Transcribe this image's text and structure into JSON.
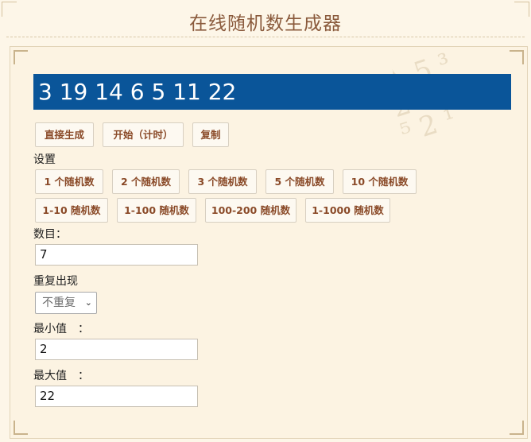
{
  "app": {
    "title": "在线随机数生成器"
  },
  "result": {
    "text": "3 19 14 6 5 11 22"
  },
  "actions": [
    {
      "label": "直接生成"
    },
    {
      "label": "开始（计时）"
    },
    {
      "label": "复制"
    }
  ],
  "settings": {
    "heading": "设置",
    "count_presets": [
      {
        "label": "1 个随机数"
      },
      {
        "label": "2 个随机数"
      },
      {
        "label": "3 个随机数"
      },
      {
        "label": "5 个随机数"
      },
      {
        "label": "10 个随机数"
      }
    ],
    "range_presets": [
      {
        "label": "1-10 随机数"
      },
      {
        "label": "1-100 随机数"
      },
      {
        "label": "100-200 随机数"
      },
      {
        "label": "1-1000 随机数"
      }
    ]
  },
  "form": {
    "count": {
      "label": "数目：",
      "value": "7"
    },
    "repeat": {
      "label": "重复出现",
      "value": "不重复"
    },
    "min": {
      "label": "最小值　：",
      "value": "2"
    },
    "max": {
      "label": "最大值　：",
      "value": "22"
    }
  },
  "icons": {
    "select_chevron": "chevron-down-icon"
  },
  "colors": {
    "accent": "#0a5599",
    "title": "#8a5a3c",
    "button_text": "#8a4a28",
    "background": "#fdf6e8"
  }
}
